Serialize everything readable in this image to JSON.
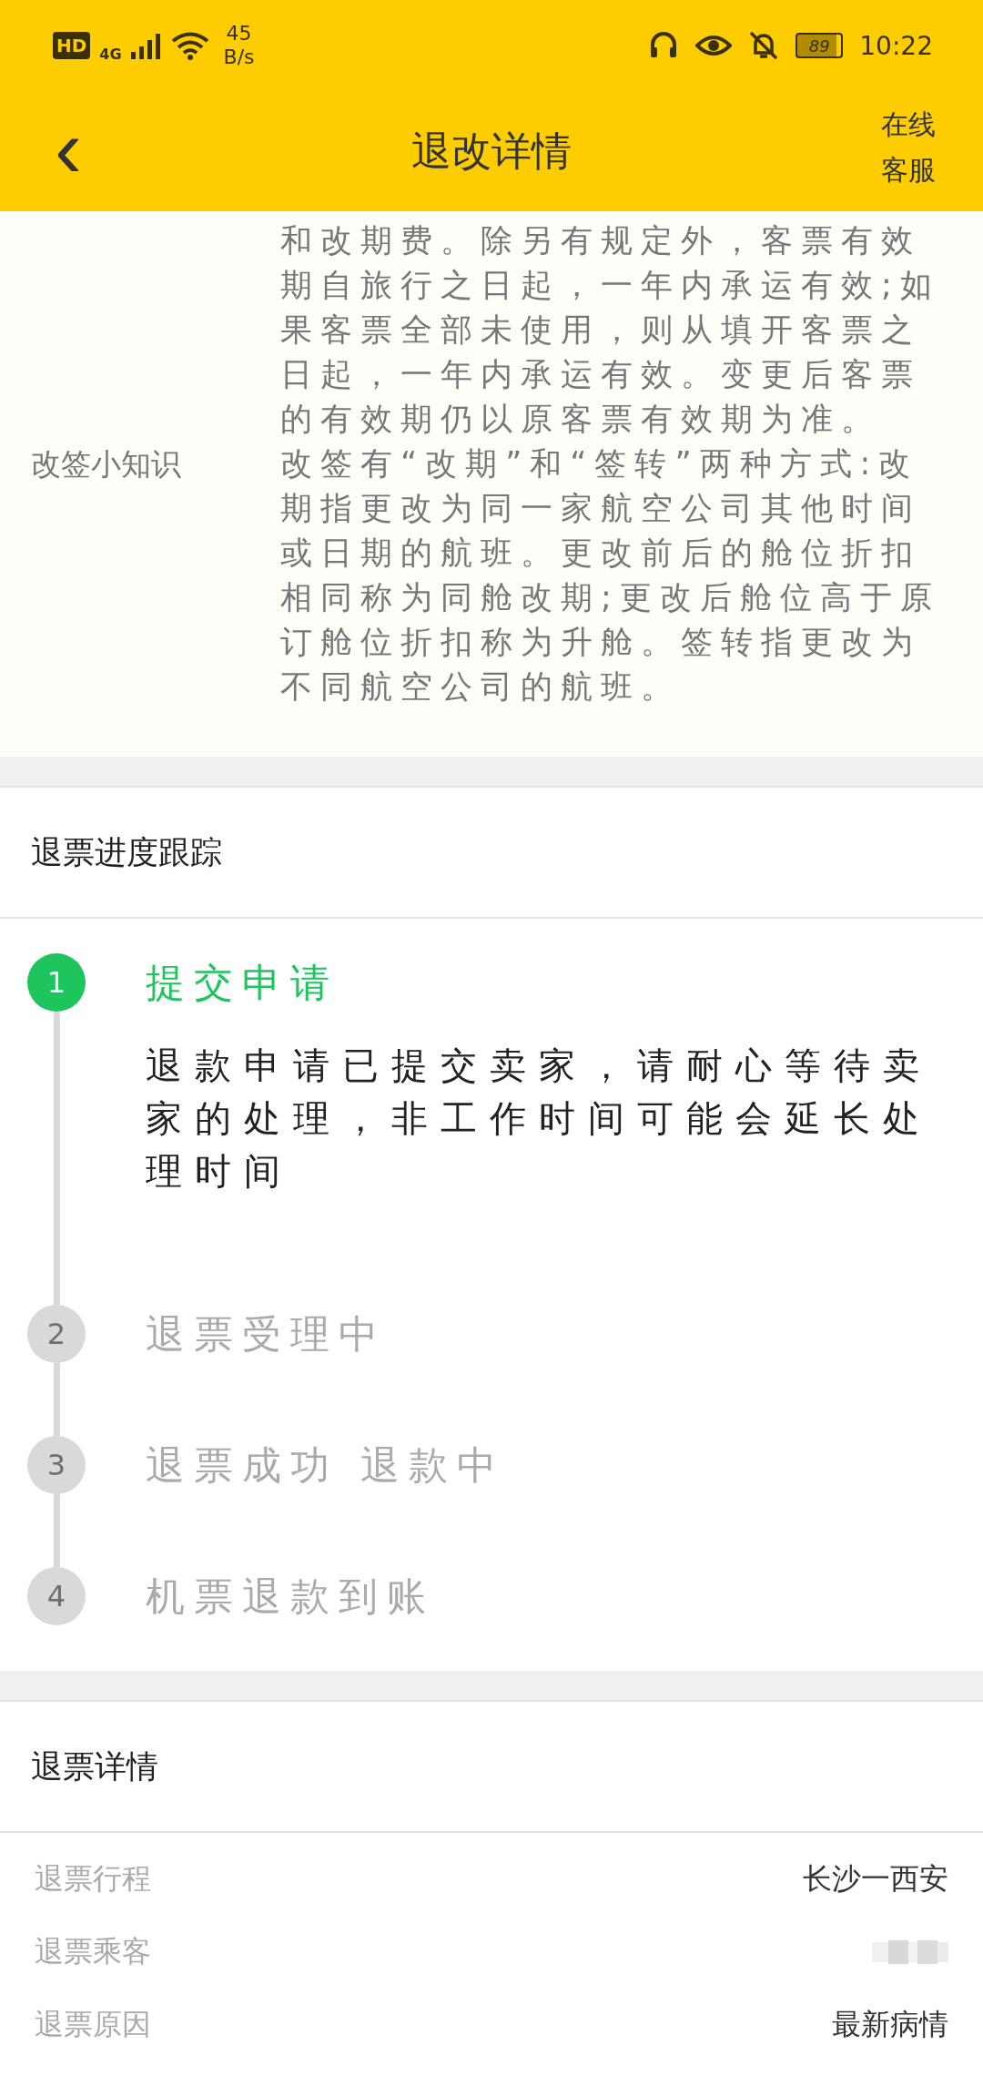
{
  "status_bar": {
    "hd": "HD",
    "network": "4G",
    "speed_value": "45",
    "speed_unit": "B/s",
    "battery": "89",
    "time": "10:22"
  },
  "header": {
    "back": "‹",
    "title": "退改详情",
    "service": [
      "在线",
      "客服"
    ]
  },
  "rules": [
    {
      "text": "和改期费。除另有规定外，客票有效期自旅行之日起，一年内承运有效;如果客票全部未使用，则从填开客票之日起，一年内承运有效。变更后客票的有效期仍以原客票有效期为准。"
    },
    {
      "label": "改签小知识",
      "text": "改签有“改期”和“签转”两种方式:改期指更改为同一家航空公司其他时间或日期的航班。更改前后的舱位折扣相同称为同舱改期;更改后舱位高于原订舱位折扣称为升舱。签转指更改为不同航空公司的航班。"
    }
  ],
  "progress": {
    "title": "退票进度跟踪",
    "steps": [
      {
        "number": "1",
        "title": "提交申请",
        "active": true,
        "description": "退款申请已提交卖家，请耐心等待卖家的处理，非工作时间可能会延长处理时间"
      },
      {
        "number": "2",
        "title": "退票受理中",
        "active": false
      },
      {
        "number": "3",
        "title": "退票成功 退款中",
        "active": false
      },
      {
        "number": "4",
        "title": "机票退款到账",
        "active": false
      }
    ]
  },
  "details": {
    "title": "退票详情",
    "rows": [
      {
        "label": "退票行程",
        "value": "长沙一西安",
        "kind": "text"
      },
      {
        "label": "退票乘客",
        "kind": "redacted"
      },
      {
        "label": "退票原因",
        "value": "最新病情",
        "kind": "text"
      }
    ]
  }
}
